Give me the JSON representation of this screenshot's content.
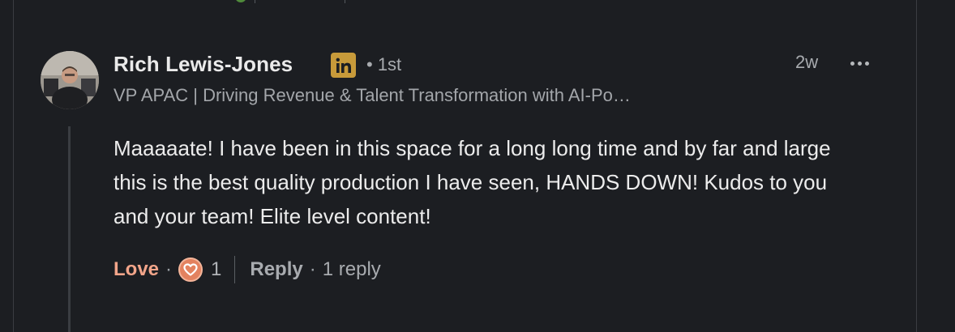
{
  "comment": {
    "author_name": "Rich Lewis-Jones",
    "badge_label": "in",
    "connection_degree": "• 1st",
    "timestamp": "2w",
    "headline": "VP APAC | Driving Revenue & Talent Transformation with AI-Po…",
    "body": "Maaaaate! I have been in this space for a long long time and by far and large this is the best quality production I have seen, HANDS DOWN! Kudos to you and your team! Elite level content!"
  },
  "actions": {
    "love_label": "Love",
    "separator": "·",
    "reaction_count": "1",
    "reply_label": "Reply",
    "reply_count": "1 reply"
  },
  "colors": {
    "background": "#1c1e22",
    "love_accent": "#f2a58a",
    "badge_gold": "#c79a3a"
  },
  "icons": {
    "badge": "linkedin-icon",
    "reaction": "heart-icon",
    "more": "ellipsis-icon"
  }
}
